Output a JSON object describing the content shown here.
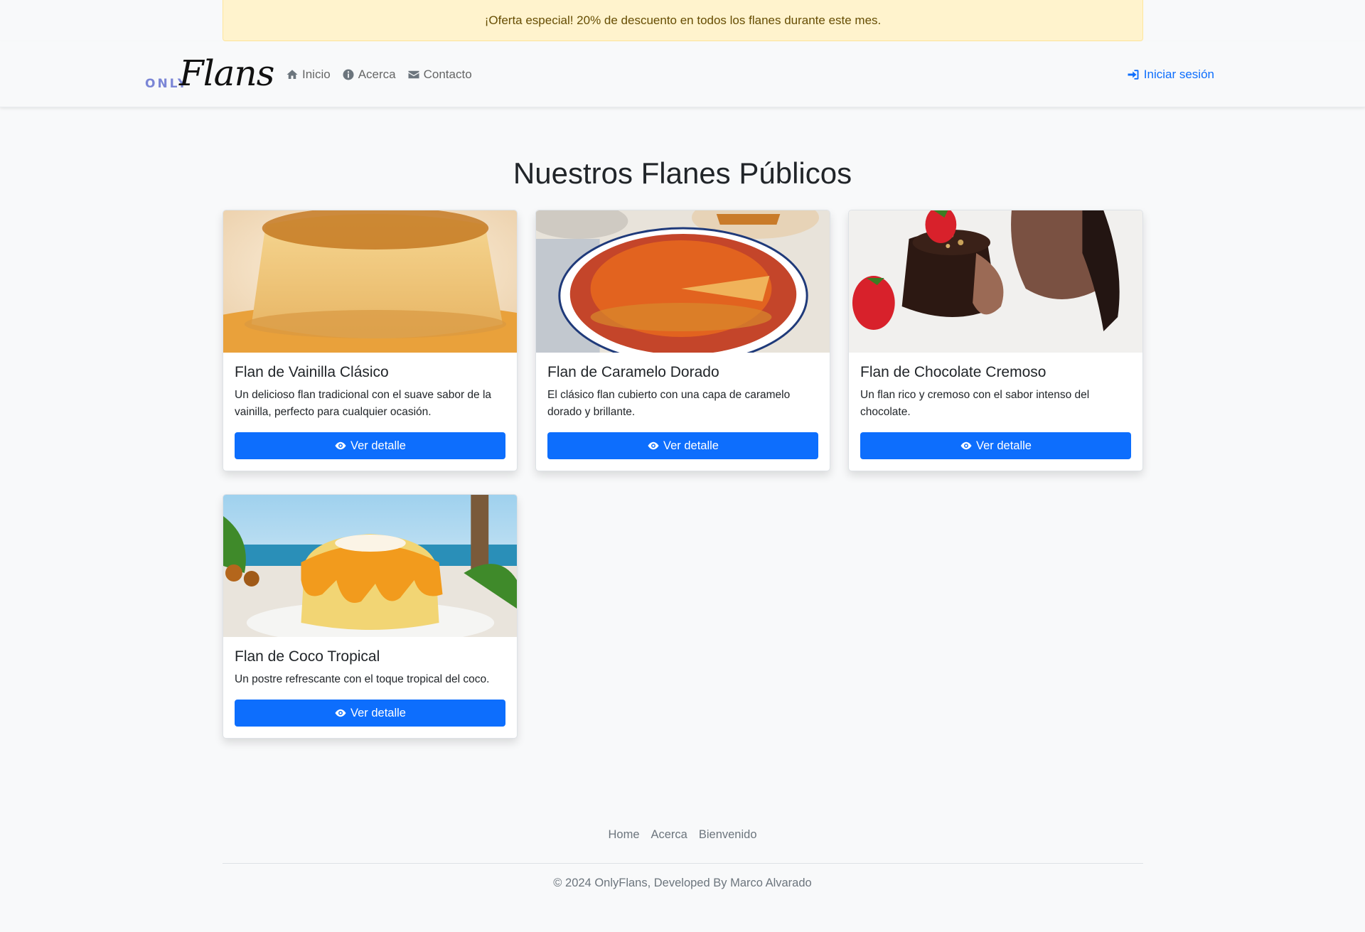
{
  "promo": {
    "text": "¡Oferta especial! 20% de descuento en todos los flanes durante este mes."
  },
  "brand": {
    "only": "ONLY",
    "flans": "Flans"
  },
  "nav": {
    "items": [
      {
        "label": "Inicio",
        "icon": "home-icon"
      },
      {
        "label": "Acerca",
        "icon": "info-icon"
      },
      {
        "label": "Contacto",
        "icon": "envelope-icon"
      }
    ],
    "login": {
      "label": "Iniciar sesión",
      "icon": "sign-in-icon"
    }
  },
  "main": {
    "title": "Nuestros Flanes Públicos",
    "cards": [
      {
        "title": "Flan de Vainilla Clásico",
        "text": "Un delicioso flan tradicional con el suave sabor de la vainilla, perfecto para cualquier ocasión.",
        "button": "Ver detalle"
      },
      {
        "title": "Flan de Caramelo Dorado",
        "text": "El clásico flan cubierto con una capa de caramelo dorado y brillante.",
        "button": "Ver detalle"
      },
      {
        "title": "Flan de Chocolate Cremoso",
        "text": "Un flan rico y cremoso con el sabor intenso del chocolate.",
        "button": "Ver detalle"
      },
      {
        "title": "Flan de Coco Tropical",
        "text": "Un postre refrescante con el toque tropical del coco.",
        "button": "Ver detalle"
      }
    ]
  },
  "footer": {
    "links": [
      "Home",
      "Acerca",
      "Bienvenido"
    ],
    "copyright": "© 2024 OnlyFlans, Developed By Marco Alvarado"
  },
  "colors": {
    "primary": "#0d6efd",
    "promo_bg": "#fff3cd",
    "promo_text": "#664d03",
    "page_bg": "#f8f9fa"
  }
}
